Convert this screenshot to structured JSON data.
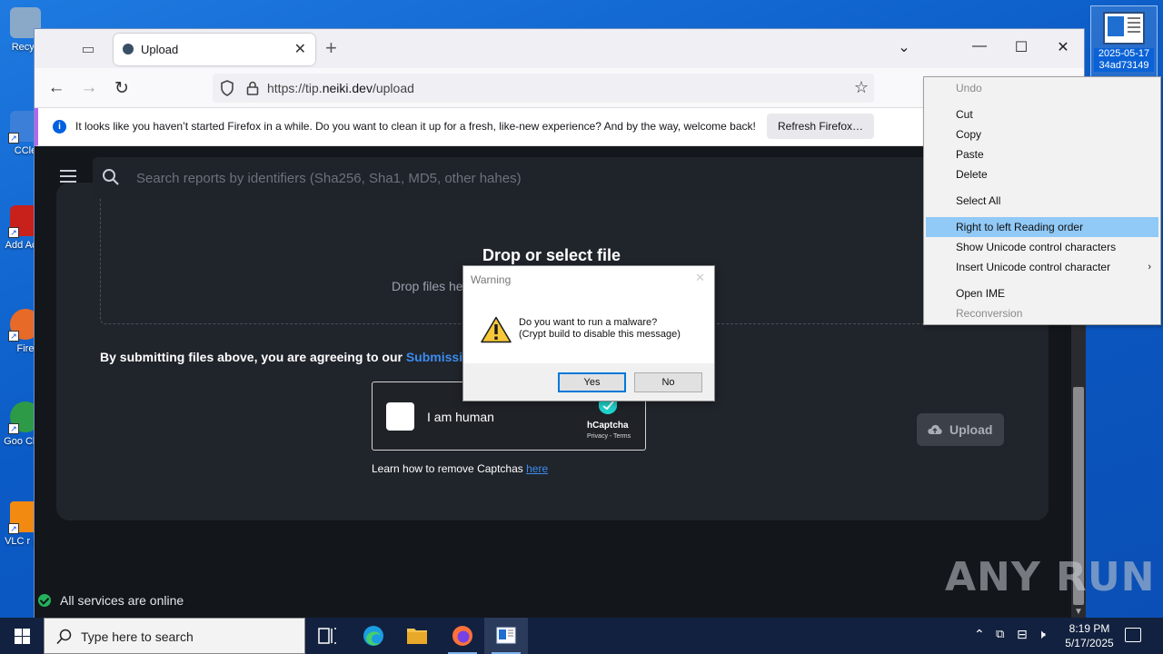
{
  "desktop": {
    "icons": [
      {
        "label": "Recyc",
        "color": "#8aa9c9"
      },
      {
        "label": "CCle",
        "color": "#3c7fd8"
      },
      {
        "label": "Add Acro",
        "color": "#c8201b"
      },
      {
        "label": "Fire",
        "color": "#e86a28"
      },
      {
        "label": "Goo Chro",
        "color": "#2d9a47"
      },
      {
        "label": "VLC r pla",
        "color": "#f28a12"
      }
    ],
    "tray_thumb_label": "2025-05-17 34ad73149"
  },
  "browser": {
    "tab_title": "Upload",
    "url_prefix": "https://tip.",
    "url_domain": "neiki.dev",
    "url_path": "/upload",
    "notification": "It looks like you haven’t started Firefox in a while. Do you want to clean it up for a fresh, like-new experience? And by the way, welcome back!",
    "refresh_button": "Refresh Firefox…"
  },
  "page": {
    "search_placeholder": "Search reports by identifiers (Sha256, Sha1, MD5, other hahes)",
    "drop_title": "Drop or select file",
    "drop_sub": "Drop files he",
    "agree_text": "By submitting files above, you are agreeing to our ",
    "agree_link": "Submission",
    "captcha_label": "I am human",
    "captcha_brand": "hCaptcha",
    "captcha_terms": "Privacy - Terms",
    "learn_text": "Learn how to remove Captchas ",
    "learn_link": "here",
    "upload_button": "Upload",
    "status": "All services are online",
    "watermark": "ANY RUN"
  },
  "dialog": {
    "title": "Warning",
    "line1": "Do you want to run a malware?",
    "line2": "(Crypt build to disable this message)",
    "yes": "Yes",
    "no": "No"
  },
  "context_menu": {
    "undo": "Undo",
    "cut": "Cut",
    "copy": "Copy",
    "paste": "Paste",
    "delete": "Delete",
    "select_all": "Select All",
    "rtl": "Right to left Reading order",
    "show_unicode": "Show Unicode control characters",
    "insert_unicode": "Insert Unicode control character",
    "open_ime": "Open IME",
    "reconversion": "Reconversion"
  },
  "taskbar": {
    "search_placeholder": "Type here to search",
    "time": "8:19 PM",
    "date": "5/17/2025"
  },
  "colors": {
    "accent": "#0078d7",
    "link": "#3b8cf0",
    "online": "#22b35b",
    "menu_highlight": "#91c9f7"
  }
}
